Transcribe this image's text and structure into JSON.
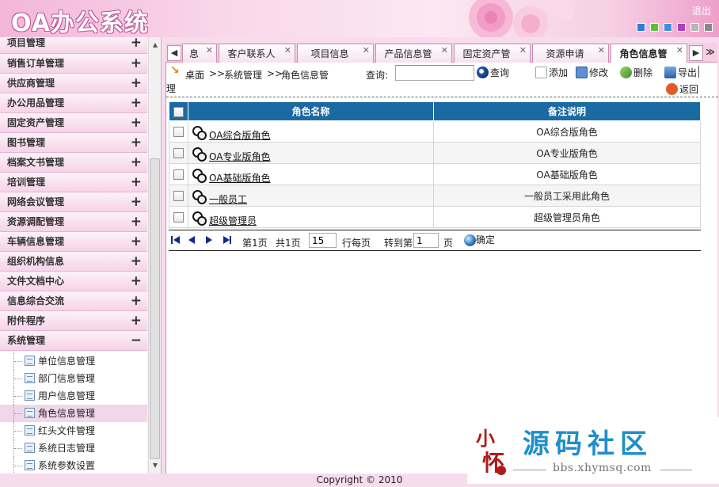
{
  "header": {
    "logo": "OA办公系统",
    "logout": "退出",
    "skin_colors": [
      "#2b7fd4",
      "#59c23a",
      "#3d8fe0",
      "#b13fbf",
      "#b6b6b6",
      "#8a8a8a"
    ]
  },
  "sidebar": {
    "menu": [
      {
        "label": "项目管理",
        "sign": "+"
      },
      {
        "label": "销售订单管理",
        "sign": "+"
      },
      {
        "label": "供应商管理",
        "sign": "+"
      },
      {
        "label": "办公用品管理",
        "sign": "+"
      },
      {
        "label": "固定资产管理",
        "sign": "+"
      },
      {
        "label": "图书管理",
        "sign": "+"
      },
      {
        "label": "档案文书管理",
        "sign": "+"
      },
      {
        "label": "培训管理",
        "sign": "+"
      },
      {
        "label": "网络会议管理",
        "sign": "+"
      },
      {
        "label": "资源调配管理",
        "sign": "+"
      },
      {
        "label": "车辆信息管理",
        "sign": "+"
      },
      {
        "label": "组织机构信息",
        "sign": "+"
      },
      {
        "label": "文件文档中心",
        "sign": "+"
      },
      {
        "label": "信息综合交流",
        "sign": "+"
      },
      {
        "label": "附件程序",
        "sign": "+"
      },
      {
        "label": "系统管理",
        "sign": "−"
      }
    ],
    "submenu": [
      {
        "label": "单位信息管理"
      },
      {
        "label": "部门信息管理"
      },
      {
        "label": "用户信息管理"
      },
      {
        "label": "角色信息管理"
      },
      {
        "label": "红头文件管理"
      },
      {
        "label": "系统日志管理"
      },
      {
        "label": "系统参数设置"
      }
    ]
  },
  "tabs": [
    {
      "label": "息"
    },
    {
      "label": "客户联系人"
    },
    {
      "label": "项目信息"
    },
    {
      "label": "产品信息管"
    },
    {
      "label": "固定资产管"
    },
    {
      "label": "资源申请"
    },
    {
      "label": "角色信息管"
    }
  ],
  "toolbar": {
    "breadcrumb_1": "桌面",
    "breadcrumb_sep": ">>",
    "breadcrumb_2": "系统管理",
    "breadcrumb_3": "角色信息管",
    "breadcrumb_wrap": "理",
    "search_label": "查询:",
    "search_value": "",
    "search_btn": "查询",
    "add_btn": "添加",
    "edit_btn": "修改",
    "delete_btn": "删除",
    "export_btn": "导出",
    "back_btn": "返回"
  },
  "table": {
    "headers": {
      "name": "角色名称",
      "remark": "备注说明"
    },
    "rows": [
      {
        "name": "OA综合版角色",
        "remark": "OA综合版角色"
      },
      {
        "name": "OA专业版角色",
        "remark": "OA专业版角色"
      },
      {
        "name": "OA基础版角色",
        "remark": "OA基础版角色"
      },
      {
        "name": "一般员工",
        "remark": "一般员工采用此角色"
      },
      {
        "name": "超级管理员",
        "remark": "超级管理员角色"
      }
    ]
  },
  "pager": {
    "page_text": "第1页",
    "total_text": "共1页",
    "per_page_value": "15",
    "per_page_text": "行每页",
    "goto_text": "转到第",
    "goto_value": "1",
    "page_unit": "页",
    "ok": "确定"
  },
  "footer": {
    "copyright": "Copyright © 2010"
  },
  "watermark": {
    "seal": "小怀",
    "title": "源码社区",
    "url": "bbs.xhymsq.com"
  }
}
